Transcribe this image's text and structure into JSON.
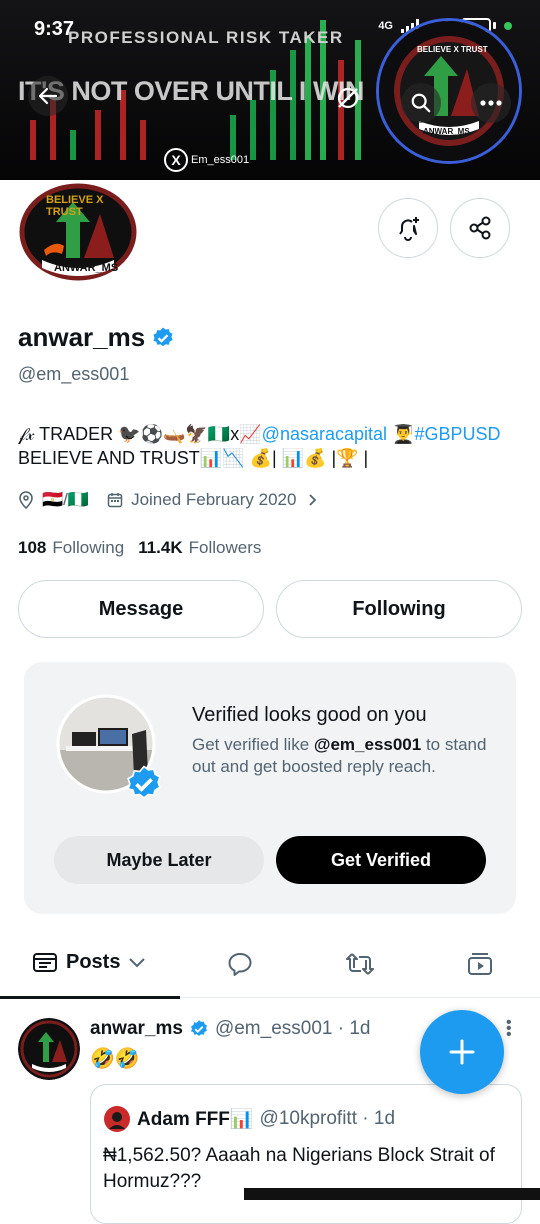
{
  "status_bar": {
    "time": "9:37",
    "network": "4G"
  },
  "banner": {
    "top_text": "PROFESSIONAL RISK TAKER",
    "big_text": "IT'S NOT OVER UNTIL I WIN",
    "handle": "Em_ess001",
    "logo_text_top": "BELIEVE X TRUST",
    "logo_text_bottom": "ANWAR_MS"
  },
  "profile": {
    "avatar_text_top": "BELIEVE X TRUST",
    "avatar_text_bottom": "ANWAR_MS",
    "display_name": "anwar_ms",
    "handle": "@em_ess001",
    "bio_prefix": "𝒻𝓍 TRADER 🐦‍⬛⚽🛶🦅🇳🇬x📈",
    "bio_link": "@nasaracapital",
    "bio_middle": "👨‍🎓",
    "bio_hashtag": "#GBPUSD",
    "bio_line2": "BELIEVE AND TRUST📊📉 💰| 📊💰 |🏆 |",
    "location": "🇪🇬/🇳🇬",
    "joined": "Joined February 2020",
    "following_count": "108",
    "following_label": "Following",
    "followers_count": "11.4K",
    "followers_label": "Followers"
  },
  "actions": {
    "message": "Message",
    "following": "Following"
  },
  "verify_card": {
    "title": "Verified looks good on you",
    "text_prefix": "Get verified like ",
    "text_handle": "@em_ess001",
    "text_suffix": " to stand out and get boosted reply reach.",
    "maybe_later": "Maybe Later",
    "get_verified": "Get Verified"
  },
  "tabs": {
    "posts": "Posts"
  },
  "post": {
    "name": "anwar_ms",
    "meta": "@em_ess001 · 1d",
    "text": "🤣🤣",
    "quote_name": "Adam FFF📊",
    "quote_meta": "@10kprofitt · 1d",
    "quote_text": "₦1,562.50? Aaaah na Nigerians Block Strait of Hormuz???"
  },
  "colors": {
    "accent": "#1d9bf0",
    "text": "#0f1419",
    "muted": "#536471",
    "border": "#cfd9de"
  }
}
